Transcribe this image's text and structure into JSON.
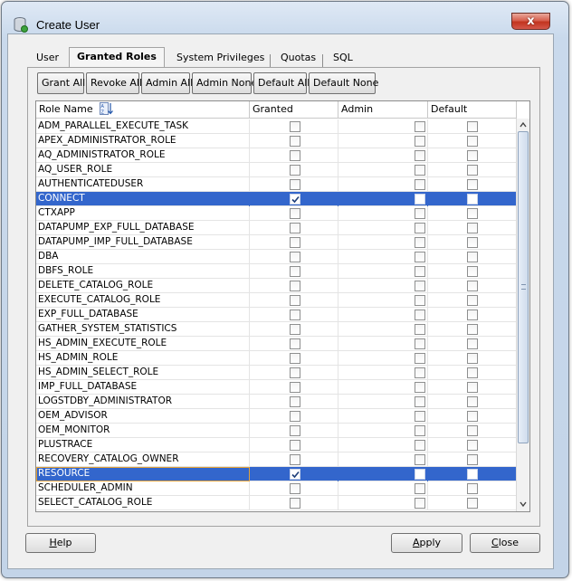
{
  "window": {
    "title": "Create User",
    "close_symbol": "x"
  },
  "tabs": [
    {
      "label": "User",
      "active": false
    },
    {
      "label": "Granted Roles",
      "active": true
    },
    {
      "label": "System Privileges",
      "active": false
    },
    {
      "label": "Quotas",
      "active": false
    },
    {
      "label": "SQL",
      "active": false
    }
  ],
  "toolbar": {
    "grant_all": "Grant All",
    "revoke_all": "Revoke All",
    "admin_all": "Admin All",
    "admin_none": "Admin None",
    "default_all": "Default All",
    "default_none": "Default None"
  },
  "grid": {
    "columns": [
      "Role Name",
      "Granted",
      "Admin",
      "Default"
    ],
    "rows": [
      {
        "name": "ADM_PARALLEL_EXECUTE_TASK",
        "granted": false,
        "admin": false,
        "default": false,
        "selected": false
      },
      {
        "name": "APEX_ADMINISTRATOR_ROLE",
        "granted": false,
        "admin": false,
        "default": false,
        "selected": false
      },
      {
        "name": "AQ_ADMINISTRATOR_ROLE",
        "granted": false,
        "admin": false,
        "default": false,
        "selected": false
      },
      {
        "name": "AQ_USER_ROLE",
        "granted": false,
        "admin": false,
        "default": false,
        "selected": false
      },
      {
        "name": "AUTHENTICATEDUSER",
        "granted": false,
        "admin": false,
        "default": false,
        "selected": false
      },
      {
        "name": "CONNECT",
        "granted": true,
        "admin": false,
        "default": false,
        "selected": true
      },
      {
        "name": "CTXAPP",
        "granted": false,
        "admin": false,
        "default": false,
        "selected": false
      },
      {
        "name": "DATAPUMP_EXP_FULL_DATABASE",
        "granted": false,
        "admin": false,
        "default": false,
        "selected": false
      },
      {
        "name": "DATAPUMP_IMP_FULL_DATABASE",
        "granted": false,
        "admin": false,
        "default": false,
        "selected": false
      },
      {
        "name": "DBA",
        "granted": false,
        "admin": false,
        "default": false,
        "selected": false
      },
      {
        "name": "DBFS_ROLE",
        "granted": false,
        "admin": false,
        "default": false,
        "selected": false
      },
      {
        "name": "DELETE_CATALOG_ROLE",
        "granted": false,
        "admin": false,
        "default": false,
        "selected": false
      },
      {
        "name": "EXECUTE_CATALOG_ROLE",
        "granted": false,
        "admin": false,
        "default": false,
        "selected": false
      },
      {
        "name": "EXP_FULL_DATABASE",
        "granted": false,
        "admin": false,
        "default": false,
        "selected": false
      },
      {
        "name": "GATHER_SYSTEM_STATISTICS",
        "granted": false,
        "admin": false,
        "default": false,
        "selected": false
      },
      {
        "name": "HS_ADMIN_EXECUTE_ROLE",
        "granted": false,
        "admin": false,
        "default": false,
        "selected": false
      },
      {
        "name": "HS_ADMIN_ROLE",
        "granted": false,
        "admin": false,
        "default": false,
        "selected": false
      },
      {
        "name": "HS_ADMIN_SELECT_ROLE",
        "granted": false,
        "admin": false,
        "default": false,
        "selected": false
      },
      {
        "name": "IMP_FULL_DATABASE",
        "granted": false,
        "admin": false,
        "default": false,
        "selected": false
      },
      {
        "name": "LOGSTDBY_ADMINISTRATOR",
        "granted": false,
        "admin": false,
        "default": false,
        "selected": false
      },
      {
        "name": "OEM_ADVISOR",
        "granted": false,
        "admin": false,
        "default": false,
        "selected": false
      },
      {
        "name": "OEM_MONITOR",
        "granted": false,
        "admin": false,
        "default": false,
        "selected": false
      },
      {
        "name": "PLUSTRACE",
        "granted": false,
        "admin": false,
        "default": false,
        "selected": false
      },
      {
        "name": "RECOVERY_CATALOG_OWNER",
        "granted": false,
        "admin": false,
        "default": false,
        "selected": false
      },
      {
        "name": "RESOURCE",
        "granted": true,
        "admin": false,
        "default": false,
        "selected": true
      },
      {
        "name": "SCHEDULER_ADMIN",
        "granted": false,
        "admin": false,
        "default": false,
        "selected": false
      },
      {
        "name": "SELECT_CATALOG_ROLE",
        "granted": false,
        "admin": false,
        "default": false,
        "selected": false
      }
    ]
  },
  "buttons": {
    "help": {
      "mnemonic": "H",
      "rest": "elp"
    },
    "apply": {
      "mnemonic": "A",
      "rest": "pply"
    },
    "close": {
      "mnemonic": "C",
      "rest": "lose"
    }
  },
  "colors": {
    "selection": "#3366cc",
    "focus_outline": "#e3a23a",
    "close_button": "#c2341f"
  }
}
